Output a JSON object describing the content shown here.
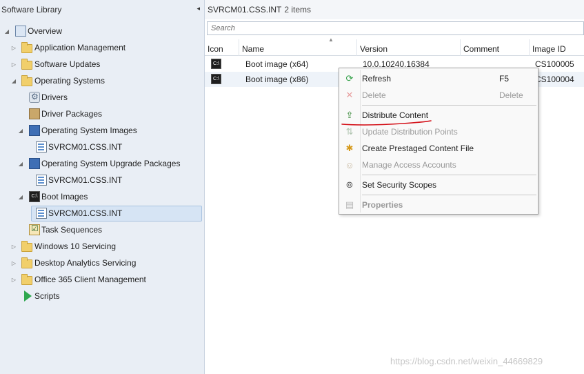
{
  "left_panel": {
    "title": "Software Library",
    "collapse_glyph": "◂",
    "tree": [
      {
        "label": "Overview",
        "expander": "◢",
        "icon": "overview-icon"
      },
      {
        "label": "Application Management",
        "expander": "▷",
        "icon": "folder-icon"
      },
      {
        "label": "Software Updates",
        "expander": "▷",
        "icon": "folder-icon"
      },
      {
        "label": "Operating Systems",
        "expander": "◢",
        "icon": "folder-icon"
      },
      {
        "label": "Drivers",
        "expander": "",
        "icon": "driver-icon"
      },
      {
        "label": "Driver Packages",
        "expander": "",
        "icon": "driver-package-icon"
      },
      {
        "label": "Operating System Images",
        "expander": "◢",
        "icon": "os-image-icon"
      },
      {
        "label": "SVRCM01.CSS.INT",
        "expander": "",
        "icon": "server-icon"
      },
      {
        "label": "Operating System Upgrade Packages",
        "expander": "◢",
        "icon": "os-upgrade-icon"
      },
      {
        "label": "SVRCM01.CSS.INT",
        "expander": "",
        "icon": "server-icon"
      },
      {
        "label": "Boot Images",
        "expander": "◢",
        "icon": "boot-image-icon"
      },
      {
        "label": "SVRCM01.CSS.INT",
        "expander": "",
        "icon": "server-icon"
      },
      {
        "label": "Task Sequences",
        "expander": "",
        "icon": "task-sequence-icon"
      },
      {
        "label": "Windows 10 Servicing",
        "expander": "▷",
        "icon": "folder-icon"
      },
      {
        "label": "Desktop Analytics Servicing",
        "expander": "▷",
        "icon": "folder-icon"
      },
      {
        "label": "Office 365 Client Management",
        "expander": "▷",
        "icon": "folder-icon"
      },
      {
        "label": "Scripts",
        "expander": "",
        "icon": "scripts-icon"
      }
    ]
  },
  "right_panel": {
    "location": "SVRCM01.CSS.INT",
    "item_count": "2 items",
    "search_placeholder": "Search",
    "sort_glyph": "▲",
    "columns": [
      "Icon",
      "Name",
      "Version",
      "Comment",
      "Image ID"
    ],
    "rows": [
      {
        "name": "Boot image (x64)",
        "version": "10.0.10240.16384",
        "comment": "",
        "image_id": "CS100005"
      },
      {
        "name": "Boot image (x86)",
        "version": "",
        "comment": "",
        "image_id": "CS100004"
      }
    ]
  },
  "context_menu": {
    "items": [
      {
        "label": "Refresh",
        "shortcut": "F5",
        "icon": "refresh-icon",
        "glyph": "⟳"
      },
      {
        "label": "Delete",
        "shortcut": "Delete",
        "icon": "delete-icon",
        "glyph": "✕"
      },
      {
        "label": "Distribute Content",
        "shortcut": "",
        "icon": "distribute-content-icon",
        "glyph": "⇪"
      },
      {
        "label": "Update Distribution Points",
        "shortcut": "",
        "icon": "update-dp-icon",
        "glyph": "⇅"
      },
      {
        "label": "Create Prestaged Content File",
        "shortcut": "",
        "icon": "prestaged-file-icon",
        "glyph": "✱"
      },
      {
        "label": "Manage Access Accounts",
        "shortcut": "",
        "icon": "access-accounts-icon",
        "glyph": "☺"
      },
      {
        "label": "Set Security Scopes",
        "shortcut": "",
        "icon": "security-scope-icon",
        "glyph": "⊚"
      },
      {
        "label": "Properties",
        "shortcut": "",
        "icon": "properties-icon",
        "glyph": "▤"
      }
    ]
  },
  "watermark": "https://blog.csdn.net/weixin_44669829",
  "colors": {
    "panel_bg": "#e9eef5",
    "selection": "#d6e4f4",
    "annotation_red": "#d4141c"
  }
}
